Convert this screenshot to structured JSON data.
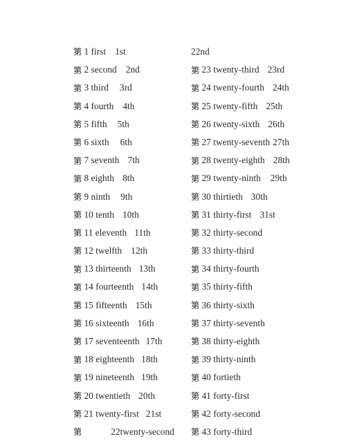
{
  "document": {
    "type": "ordinal-numbers-reference",
    "ordinal_prefix": "第",
    "background_color": "#ffffff",
    "text_color": "#2b2b2b"
  },
  "columns": {
    "left": [
      {
        "prefix": "第",
        "number": "1",
        "word": "first",
        "abbr": "1st",
        "gap": 13
      },
      {
        "prefix": "第",
        "number": "2",
        "word": "second",
        "abbr": "2nd",
        "gap": 13
      },
      {
        "prefix": "第",
        "number": "3",
        "word": "third",
        "abbr": "3rd",
        "gap": 16
      },
      {
        "prefix": "第",
        "number": "4",
        "word": "fourth",
        "abbr": "4th",
        "gap": 13
      },
      {
        "prefix": "第",
        "number": "5",
        "word": "fifth",
        "abbr": "5th",
        "gap": 15
      },
      {
        "prefix": "第",
        "number": "6",
        "word": "sixth",
        "abbr": "6th",
        "gap": 16
      },
      {
        "prefix": "第",
        "number": "7",
        "word": "seventh",
        "abbr": "7th",
        "gap": 12
      },
      {
        "prefix": "第",
        "number": "8",
        "word": "eighth",
        "abbr": "8th",
        "gap": 12
      },
      {
        "prefix": "第",
        "number": "9",
        "word": "ninth",
        "abbr": "9th",
        "gap": 15
      },
      {
        "prefix": "第",
        "number": "10",
        "word": "tenth",
        "abbr": "10th",
        "gap": 12
      },
      {
        "prefix": "第",
        "number": "11",
        "word": "eleventh",
        "abbr": "11th",
        "gap": 11
      },
      {
        "prefix": "第",
        "number": "12",
        "word": "twelfth",
        "abbr": "12th",
        "gap": 13
      },
      {
        "prefix": "第",
        "number": "13",
        "word": "thirteenth",
        "abbr": "13th",
        "gap": 11
      },
      {
        "prefix": "第",
        "number": "14",
        "word": "fourteenth",
        "abbr": "14th",
        "gap": 11
      },
      {
        "prefix": "第",
        "number": "15",
        "word": "fifteenth",
        "abbr": "15th",
        "gap": 12
      },
      {
        "prefix": "第",
        "number": "16",
        "word": "sixteenth",
        "abbr": "16th",
        "gap": 12
      },
      {
        "prefix": "第",
        "number": "17",
        "word": "seventeenth",
        "abbr": "17th",
        "gap": 9
      },
      {
        "prefix": "第",
        "number": "18",
        "word": "eighteenth",
        "abbr": "18th",
        "gap": 10
      },
      {
        "prefix": "第",
        "number": "19",
        "word": "nineteenth",
        "abbr": "19th",
        "gap": 10
      },
      {
        "prefix": "第",
        "number": "20",
        "word": "twentieth",
        "abbr": "20th",
        "gap": 12
      },
      {
        "prefix": "第",
        "number": "21",
        "word": "twenty-first",
        "abbr": "21st",
        "gap": 10
      },
      {
        "prefix": "第",
        "number": "22",
        "word": "twenty-second",
        "abbr": "",
        "irregular": true
      }
    ],
    "right": [
      {
        "prefix": "",
        "number": "",
        "word": "",
        "abbr": "22nd",
        "orphan": true
      },
      {
        "prefix": "第",
        "number": "23",
        "word": "twenty-third",
        "abbr": "23rd",
        "gap": 12
      },
      {
        "prefix": "第",
        "number": "24",
        "word": "twenty-fourth",
        "abbr": "24th",
        "gap": 12
      },
      {
        "prefix": "第",
        "number": "25",
        "word": "twenty-fifth",
        "abbr": "25th",
        "gap": 12
      },
      {
        "prefix": "第",
        "number": "26",
        "word": "twenty-sixth",
        "abbr": "26th",
        "gap": 12
      },
      {
        "prefix": "第",
        "number": "27",
        "word": "twenty-seventh",
        "abbr": "27th",
        "gap": 4
      },
      {
        "prefix": "第",
        "number": "28",
        "word": "twenty-eighth",
        "abbr": "28th",
        "gap": 12
      },
      {
        "prefix": "第",
        "number": "29",
        "word": "twenty-ninth",
        "abbr": "29th",
        "gap": 14
      },
      {
        "prefix": "第",
        "number": "30",
        "word": "thirtieth",
        "abbr": "30th",
        "gap": 12
      },
      {
        "prefix": "第",
        "number": "31",
        "word": "thirty-first",
        "abbr": "31st",
        "gap": 12
      },
      {
        "prefix": "第",
        "number": "32",
        "word": "thirty-second",
        "abbr": ""
      },
      {
        "prefix": "第",
        "number": "33",
        "word": "thirty-third",
        "abbr": ""
      },
      {
        "prefix": "第",
        "number": "34",
        "word": "thirty-fourth",
        "abbr": ""
      },
      {
        "prefix": "第",
        "number": "35",
        "word": "thirty-fifth",
        "abbr": ""
      },
      {
        "prefix": "第",
        "number": "36",
        "word": "thirty-sixth",
        "abbr": ""
      },
      {
        "prefix": "第",
        "number": "37",
        "word": "thirty-seventh",
        "abbr": ""
      },
      {
        "prefix": "第",
        "number": "38",
        "word": "thirty-eighth",
        "abbr": ""
      },
      {
        "prefix": "第",
        "number": "39",
        "word": "thirty-ninth",
        "abbr": ""
      },
      {
        "prefix": "第",
        "number": "40",
        "word": "fortieth",
        "abbr": ""
      },
      {
        "prefix": "第",
        "number": "41",
        "word": "forty-first",
        "abbr": ""
      },
      {
        "prefix": "第",
        "number": "42",
        "word": "forty-second",
        "abbr": ""
      },
      {
        "prefix": "第",
        "number": "43",
        "word": "forty-third",
        "abbr": ""
      }
    ]
  }
}
